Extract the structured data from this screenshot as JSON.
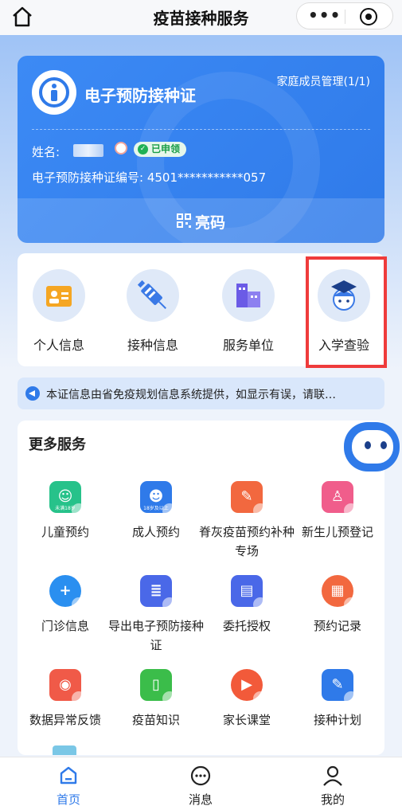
{
  "header": {
    "title": "疫苗接种服务",
    "more_icon": "more-dots-icon",
    "close_icon": "target-icon"
  },
  "certificate": {
    "title": "电子预防接种证",
    "family_link": "家庭成员管理(1/1)",
    "name_label": "姓名:",
    "status_badge": "已申领",
    "cert_number": "电子预防接种证编号: 4501***********057",
    "qr_button": "亮码"
  },
  "quick_entries": [
    {
      "label": "个人信息",
      "icon": "id-card-icon"
    },
    {
      "label": "接种信息",
      "icon": "syringe-icon"
    },
    {
      "label": "服务单位",
      "icon": "building-icon"
    },
    {
      "label": "入学查验",
      "icon": "student-icon"
    }
  ],
  "notice": {
    "text": "本证信息由省免疫规划信息系统提供，如显示有误，请联…"
  },
  "more_services": {
    "title": "更多服务",
    "items": [
      {
        "label": "儿童预约",
        "icon": "child-icon",
        "icon_text": "未满18岁",
        "color": "#27c28a"
      },
      {
        "label": "成人预约",
        "icon": "adult-icon",
        "icon_text": "18岁及以上",
        "color": "#2f7ae9"
      },
      {
        "label": "脊灰疫苗预约补种专场",
        "icon": "vaccine-icon",
        "color": "#f2683f"
      },
      {
        "label": "新生儿预登记",
        "icon": "stroller-icon",
        "color": "#f05d8b"
      },
      {
        "label": "门诊信息",
        "icon": "clinic-icon",
        "color": "#2a8ff0"
      },
      {
        "label": "导出电子预防接种证",
        "icon": "export-icon",
        "color": "#4a68e8"
      },
      {
        "label": "委托授权",
        "icon": "authorize-icon",
        "color": "#4a68e8"
      },
      {
        "label": "预约记录",
        "icon": "calendar-icon",
        "color": "#f2683f"
      },
      {
        "label": "数据异常反馈",
        "icon": "feedback-icon",
        "color": "#f05a48"
      },
      {
        "label": "疫苗知识",
        "icon": "book-icon",
        "color": "#3bbd4a"
      },
      {
        "label": "家长课堂",
        "icon": "video-icon",
        "color": "#f25a3a"
      },
      {
        "label": "接种计划",
        "icon": "plan-icon",
        "color": "#2f7ae9"
      }
    ]
  },
  "tabbar": [
    {
      "label": "首页",
      "icon": "home-icon",
      "active": true,
      "color": "#2f7ae9"
    },
    {
      "label": "消息",
      "icon": "message-icon",
      "active": false,
      "color": "#222222"
    },
    {
      "label": "我的",
      "icon": "user-icon",
      "active": false,
      "color": "#222222"
    }
  ]
}
